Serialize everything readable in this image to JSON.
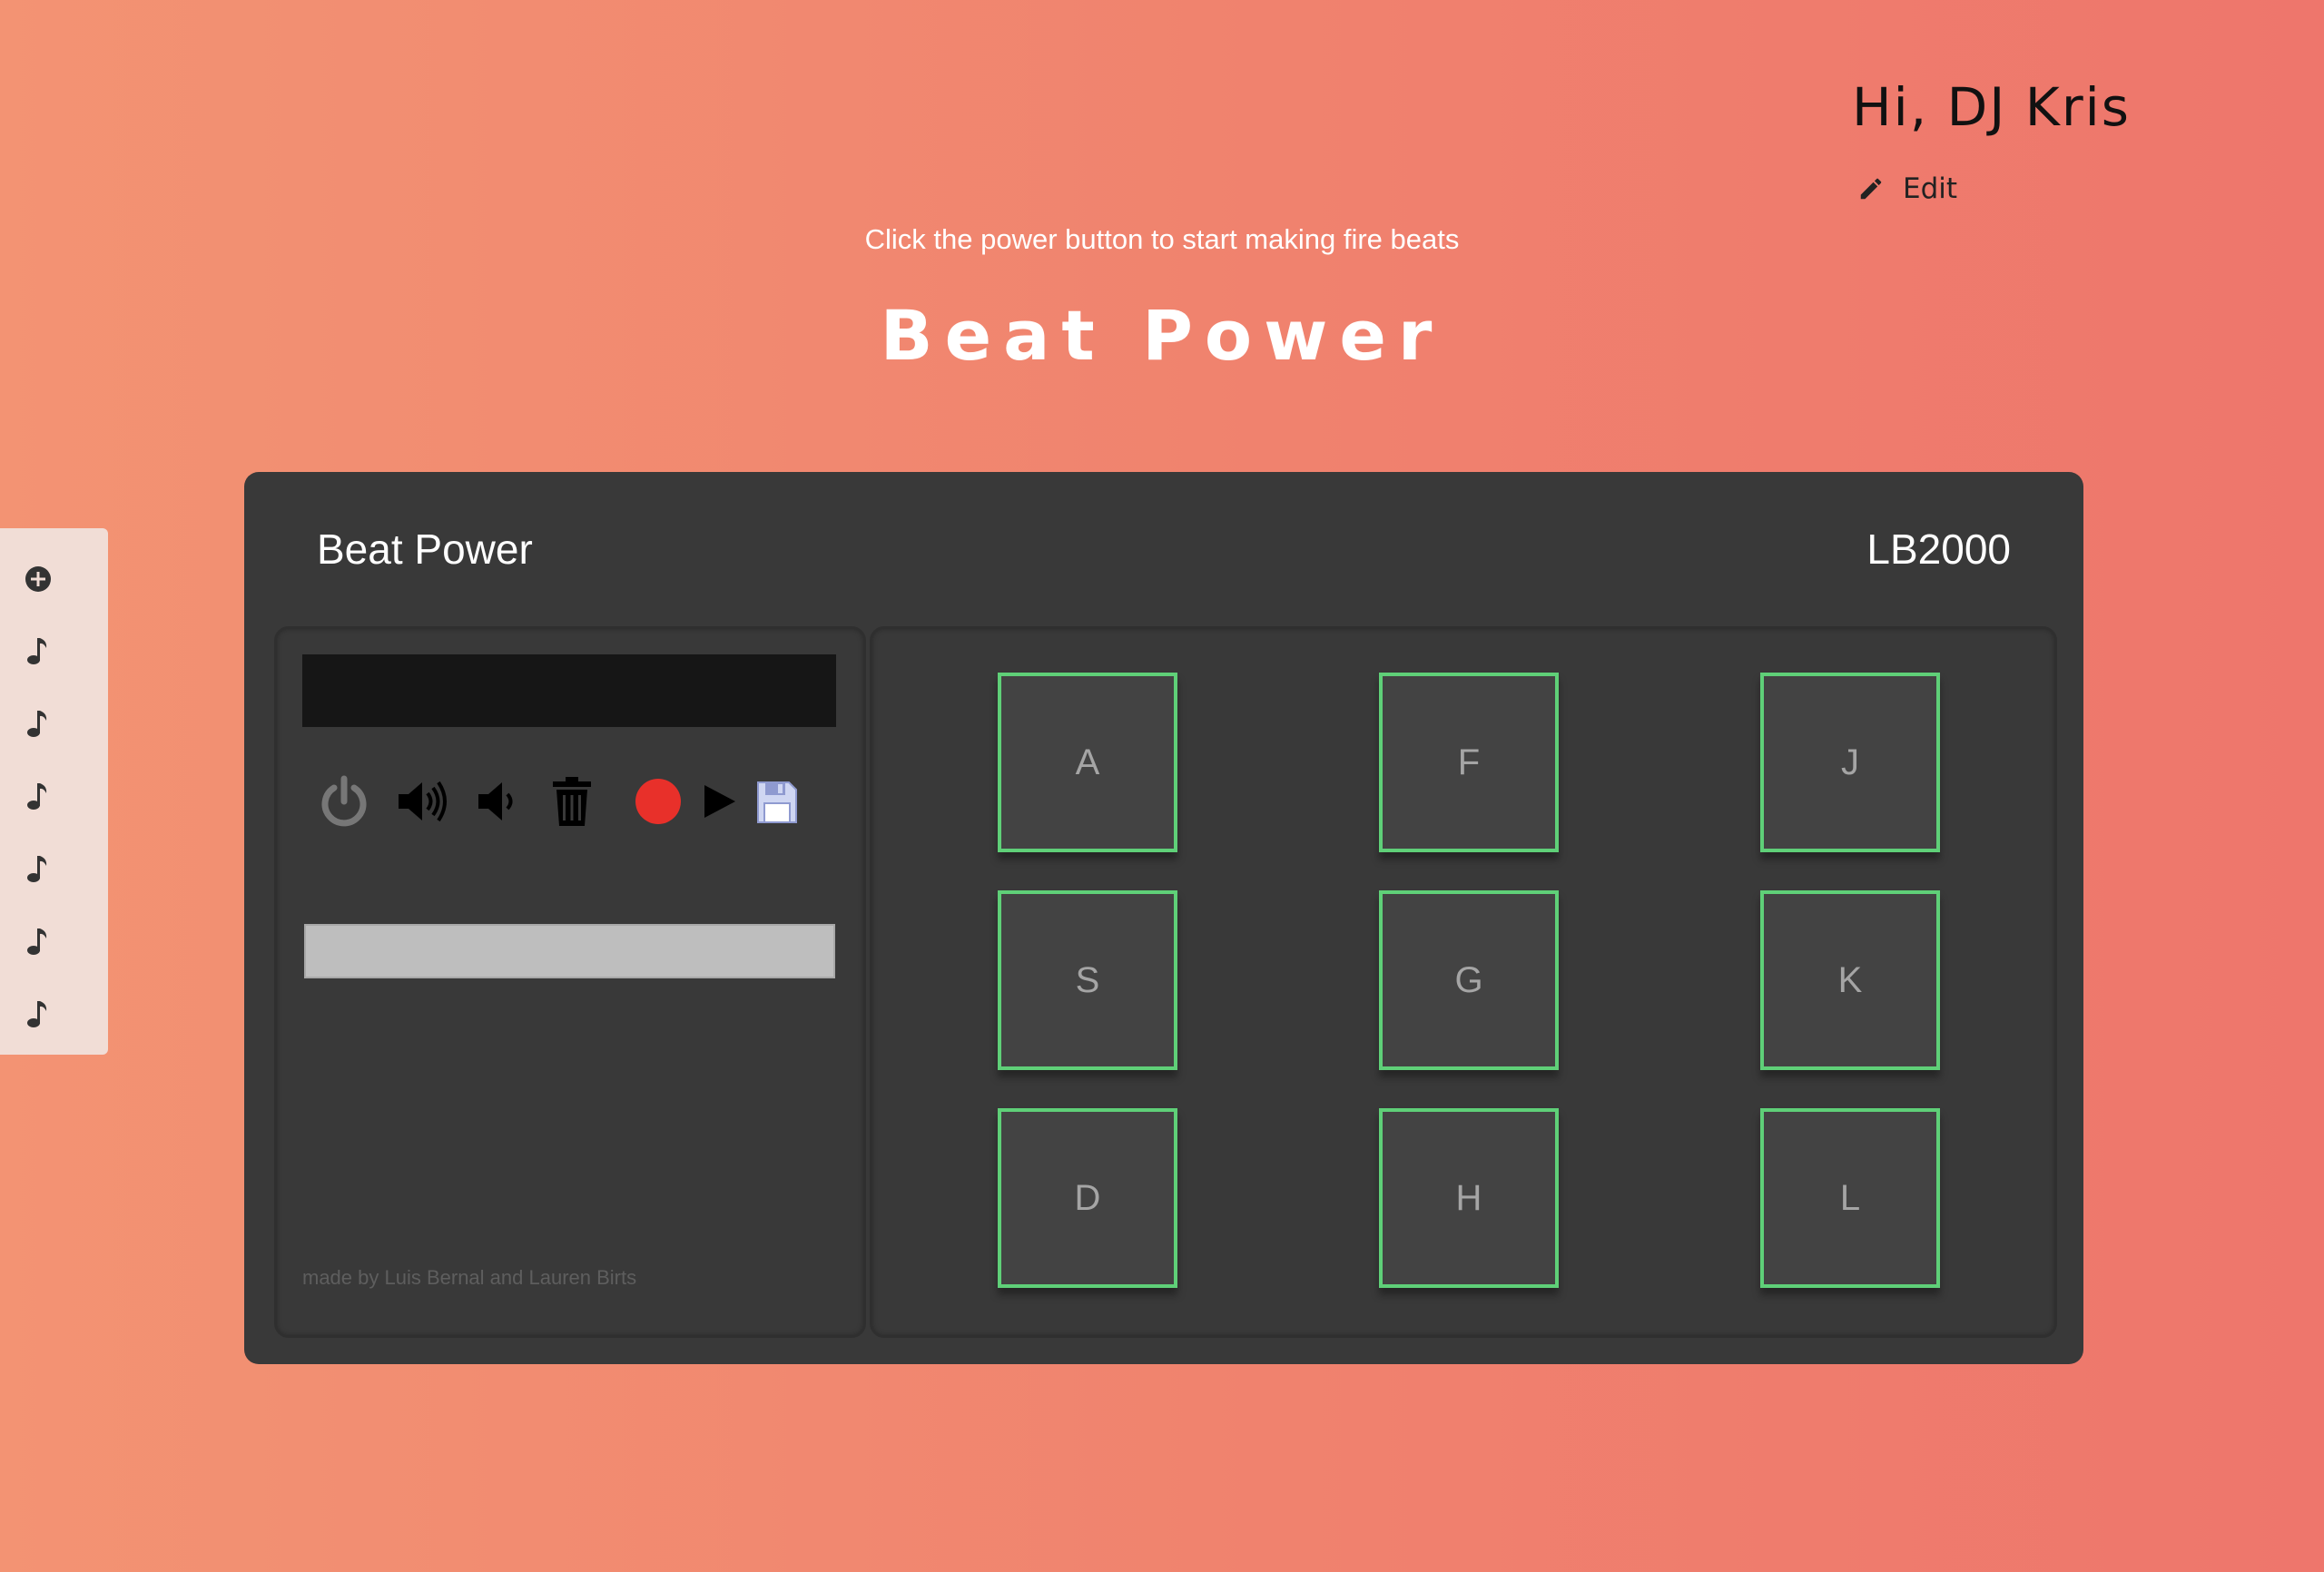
{
  "header": {
    "greeting": "Hi, DJ Kris",
    "edit_label": "Edit",
    "subtitle": "Click the power button to start making fire beats",
    "title": "Beat Power"
  },
  "sidebar": {
    "items": [
      {
        "icon": "plus-circle-icon"
      },
      {
        "icon": "music-note-icon"
      },
      {
        "icon": "music-note-icon"
      },
      {
        "icon": "music-note-icon"
      },
      {
        "icon": "music-note-icon"
      },
      {
        "icon": "music-note-icon"
      },
      {
        "icon": "music-note-icon"
      }
    ]
  },
  "console": {
    "name": "Beat Power",
    "model": "LB2000",
    "display_text": "",
    "controls": [
      {
        "icon": "power-icon"
      },
      {
        "icon": "volume-up-icon"
      },
      {
        "icon": "volume-down-icon"
      },
      {
        "icon": "trash-icon"
      },
      {
        "icon": "record-icon"
      },
      {
        "icon": "play-icon"
      },
      {
        "icon": "save-icon"
      }
    ],
    "credits": "made by Luis Bernal and Lauren Birts",
    "pads": [
      "A",
      "F",
      "J",
      "S",
      "G",
      "K",
      "D",
      "H",
      "L"
    ]
  },
  "colors": {
    "background_start": "#f39373",
    "background_end": "#ee766c",
    "console": "#393939",
    "pad_border": "#5fd078",
    "record": "#e8302a"
  }
}
